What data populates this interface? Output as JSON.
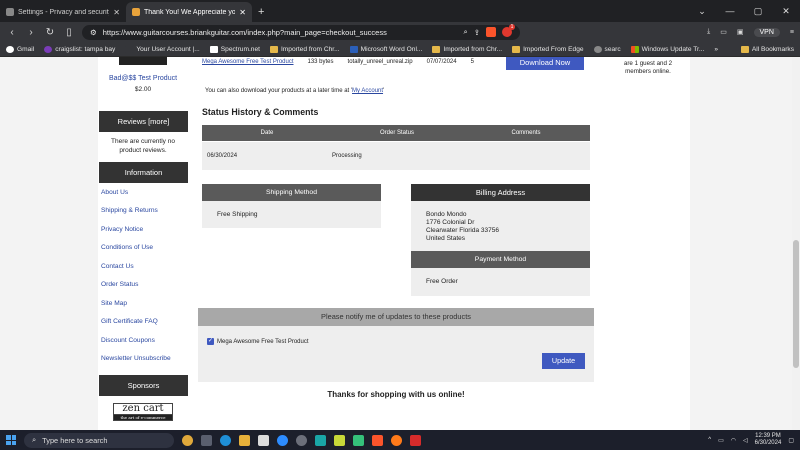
{
  "browser": {
    "tabs": [
      {
        "title": "Settings - Privacy and security",
        "active": false
      },
      {
        "title": "Thank You! We Appreciate you",
        "active": true
      }
    ],
    "new_tab": "+",
    "url": "https://www.guitarcourses.briankguitar.com/index.php?main_page=checkout_success",
    "vpn_label": "VPN",
    "bookmarks": [
      {
        "label": "Gmail",
        "icon": "gmail-icon"
      },
      {
        "label": "craigslist: tampa bay",
        "icon": "craigslist-icon"
      },
      {
        "label": "Your User Account |...",
        "icon": "account-icon"
      },
      {
        "label": "Spectrum.net",
        "icon": "spectrum-icon"
      },
      {
        "label": "Imported from Chr...",
        "icon": "folder-icon"
      },
      {
        "label": "Microsoft Word Onl...",
        "icon": "word-icon"
      },
      {
        "label": "Imported from Chr...",
        "icon": "folder-icon"
      },
      {
        "label": "Imported From Edge",
        "icon": "folder-icon"
      },
      {
        "label": "searc",
        "icon": "search-icon"
      },
      {
        "label": "Windows Update Tr...",
        "icon": "windows-icon"
      }
    ],
    "all_bookmarks": "All Bookmarks",
    "more": "»"
  },
  "sidebar": {
    "product_name": "Bad@$$ Test Product",
    "product_price": "$2.00",
    "reviews_heading": "Reviews  [more]",
    "reviews_text": "There are currently no product reviews.",
    "information_heading": "Information",
    "info_links": [
      "About Us",
      "Shipping & Returns",
      "Privacy Notice",
      "Conditions of Use",
      "Contact Us",
      "Order Status",
      "Site Map",
      "Gift Certificate FAQ",
      "Discount Coupons",
      "Newsletter Unsubscribe"
    ],
    "sponsors_heading": "Sponsors",
    "sponsor_logo": "zen cart",
    "sponsor_tagline": "the art of e-commerce"
  },
  "download": {
    "file_link": "Mega Awesome Free Test Product",
    "size": "133 bytes",
    "filename": "totally_unreel_unreal.zip",
    "date": "07/07/2024",
    "remaining": "5",
    "button": "Download Now",
    "later_prefix": "You can also download your products at a later time at '",
    "later_link": "My Account",
    "later_suffix": "'"
  },
  "status": {
    "heading": "Status History & Comments",
    "columns": [
      "Date",
      "Order Status",
      "Comments"
    ],
    "rows": [
      {
        "date": "06/30/2024",
        "status": "Processing",
        "comments": ""
      }
    ]
  },
  "shipping": {
    "heading": "Shipping Method",
    "value": "Free Shipping"
  },
  "billing": {
    "heading": "Billing Address",
    "lines": [
      "Bondo Mondo",
      "1776 Colonial Dr",
      "Clearwater Florida 33756",
      "United States"
    ]
  },
  "payment": {
    "heading": "Payment Method",
    "value": "Free Order"
  },
  "notify": {
    "heading": "Please notify me of updates to these products",
    "product": "Mega Awesome Free Test Product",
    "checked": true,
    "button": "Update"
  },
  "thanks": "Thanks for shopping with us online!",
  "right_column": {
    "whos_online": "are 1 guest and 2 members online."
  },
  "taskbar": {
    "search_placeholder": "Type here to search",
    "time": "12:39 PM",
    "date": "6/30/2024"
  }
}
